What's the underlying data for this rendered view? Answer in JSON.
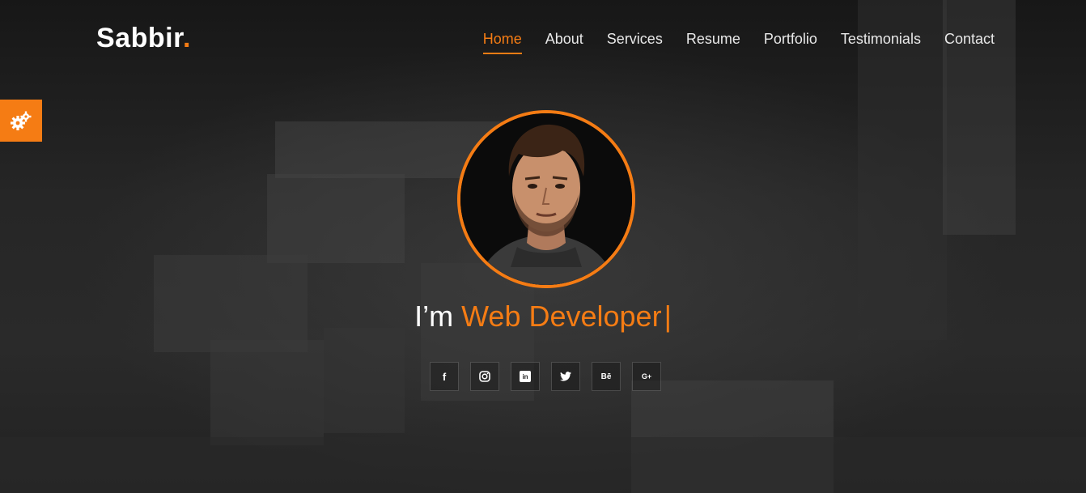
{
  "brand": {
    "name": "Sabbir",
    "dot": "."
  },
  "nav": {
    "items": [
      {
        "label": "Home",
        "active": true
      },
      {
        "label": "About"
      },
      {
        "label": "Services"
      },
      {
        "label": "Resume"
      },
      {
        "label": "Portfolio"
      },
      {
        "label": "Testimonials"
      },
      {
        "label": "Contact"
      }
    ]
  },
  "hero": {
    "prefix": "I’m",
    "typed_text": "Web Developer",
    "cursor": "|"
  },
  "social": [
    {
      "icon": "facebook-icon",
      "glyph": "f"
    },
    {
      "icon": "instagram-icon",
      "glyph": ""
    },
    {
      "icon": "linkedin-icon",
      "glyph": "in"
    },
    {
      "icon": "twitter-icon",
      "glyph": ""
    },
    {
      "icon": "behance-icon",
      "glyph": "Bē"
    },
    {
      "icon": "google-plus-icon",
      "glyph": "G+"
    }
  ],
  "colors": {
    "accent": "#f57c14",
    "text": "#ffffff",
    "background": "#1e1e1e"
  }
}
